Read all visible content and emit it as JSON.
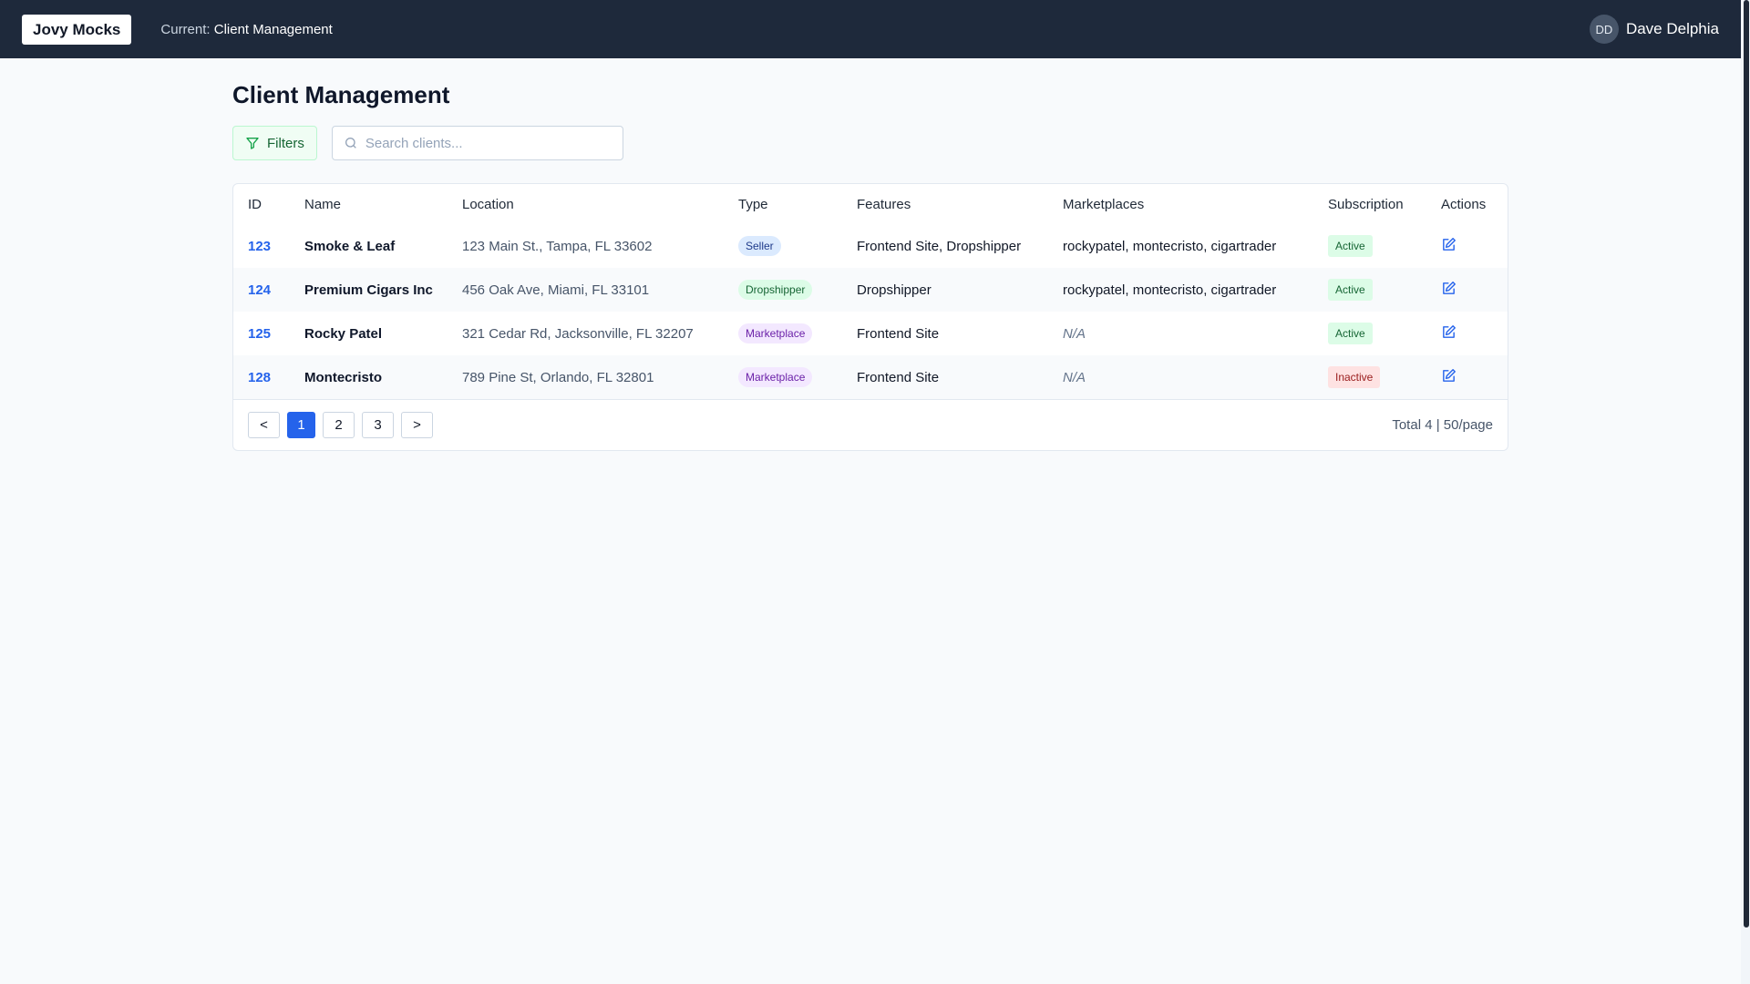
{
  "topbar": {
    "brand": "Jovy Mocks",
    "current_label": "Current:",
    "current_value": "Client Management",
    "user": {
      "initials": "DD",
      "name": "Dave Delphia"
    }
  },
  "page": {
    "title": "Client Management",
    "filters_label": "Filters",
    "search_placeholder": "Search clients...",
    "search_value": ""
  },
  "table": {
    "headers": [
      "ID",
      "Name",
      "Location",
      "Type",
      "Features",
      "Marketplaces",
      "Subscription",
      "Actions"
    ],
    "rows": [
      {
        "id": "123",
        "name": "Smoke & Leaf",
        "location": "123 Main St., Tampa, FL 33602",
        "type": "Seller",
        "features": "Frontend Site, Dropshipper",
        "marketplaces": "rockypatel, montecristo, cigartrader",
        "subscription": "Active"
      },
      {
        "id": "124",
        "name": "Premium Cigars Inc",
        "location": "456 Oak Ave, Miami, FL 33101",
        "type": "Dropshipper",
        "features": "Dropshipper",
        "marketplaces": "rockypatel, montecristo, cigartrader",
        "subscription": "Active"
      },
      {
        "id": "125",
        "name": "Rocky Patel",
        "location": "321 Cedar Rd, Jacksonville, FL 32207",
        "type": "Marketplace",
        "features": "Frontend Site",
        "marketplaces": "N/A",
        "subscription": "Active"
      },
      {
        "id": "128",
        "name": "Montecristo",
        "location": "789 Pine St, Orlando, FL 32801",
        "type": "Marketplace",
        "features": "Frontend Site",
        "marketplaces": "N/A",
        "subscription": "Inactive"
      }
    ]
  },
  "pagination": {
    "prev": "<",
    "next": ">",
    "pages": [
      "1",
      "2",
      "3"
    ],
    "current": "1",
    "info": "Total 4 | 50/page"
  },
  "colors": {
    "topbar": "#1e293b",
    "accent": "#2563eb",
    "active": "#166534",
    "inactive": "#991b1b"
  }
}
